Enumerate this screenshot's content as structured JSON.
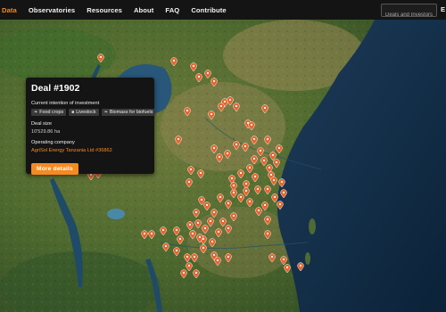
{
  "nav": {
    "items": [
      "Data",
      "Observatories",
      "Resources",
      "About",
      "FAQ",
      "Contribute"
    ],
    "active": "Data",
    "search_placeholder": "Deals and Investors",
    "lang_label": "E"
  },
  "popup": {
    "title": "Deal #1902",
    "intention_label": "Current intention of investment",
    "tags": [
      {
        "icon": "leaf-icon",
        "label": "Food crops"
      },
      {
        "icon": "cow-icon",
        "label": "Livestock"
      },
      {
        "icon": "leaf-icon",
        "label": "Biomass for biofuels"
      }
    ],
    "deal_size_label": "Deal size",
    "deal_size_value": "10'529.86 ha",
    "company_label": "Operating company",
    "company_value": "AgriSol Energy Tanzania Ltd #36862",
    "button_label": "More details"
  },
  "colors": {
    "accent": "#f58a21",
    "nav_bg": "#141414",
    "popup_bg": "#141414",
    "marker": "#e8632b",
    "ocean": "#102a44"
  },
  "map": {
    "type": "satellite",
    "marker_icon": "map-pin-icon"
  }
}
